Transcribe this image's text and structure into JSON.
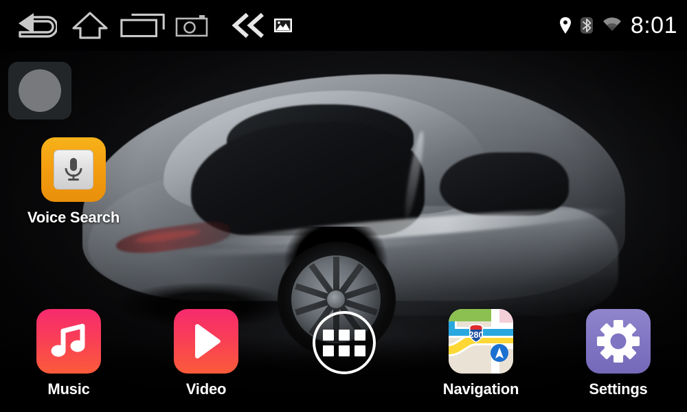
{
  "device": {
    "screen_title": "Android Car Head Unit Home Screen",
    "wallpaper_subject": "silver sports coupe on black background"
  },
  "statusbar": {
    "nav": [
      {
        "name": "back",
        "icon": "back-arrow-icon"
      },
      {
        "name": "home",
        "icon": "home-icon"
      },
      {
        "name": "recents",
        "icon": "recent-apps-icon"
      },
      {
        "name": "screenshot",
        "icon": "camera-icon"
      },
      {
        "name": "rewind",
        "icon": "double-chevron-left-icon"
      },
      {
        "name": "gallery",
        "icon": "picture-icon"
      }
    ],
    "indicators": [
      {
        "name": "location",
        "icon": "location-pin-icon",
        "state": "on"
      },
      {
        "name": "bluetooth",
        "icon": "bluetooth-icon",
        "state": "off"
      },
      {
        "name": "wifi",
        "icon": "wifi-icon",
        "state": "weak"
      }
    ],
    "clock": "8:01"
  },
  "widget": {
    "name": "clock-widget-placeholder",
    "shape": "circle"
  },
  "apps": {
    "voice_search": {
      "label": "Voice Search",
      "icon": "microphone-icon",
      "color": "#f39c10"
    },
    "music": {
      "label": "Music",
      "icon": "music-note-icon",
      "color": "#f62a6e"
    },
    "video": {
      "label": "Video",
      "icon": "play-triangle-icon",
      "color": "#fb5b3a"
    },
    "navigation": {
      "label": "Navigation",
      "icon": "map-icon",
      "highway_shield": "280",
      "color": "#ece7dc"
    },
    "settings": {
      "label": "Settings",
      "icon": "gear-icon",
      "color": "#7f74c2"
    }
  },
  "app_drawer": {
    "name": "all-apps-button",
    "icon": "grid-icon",
    "cells": 6
  }
}
